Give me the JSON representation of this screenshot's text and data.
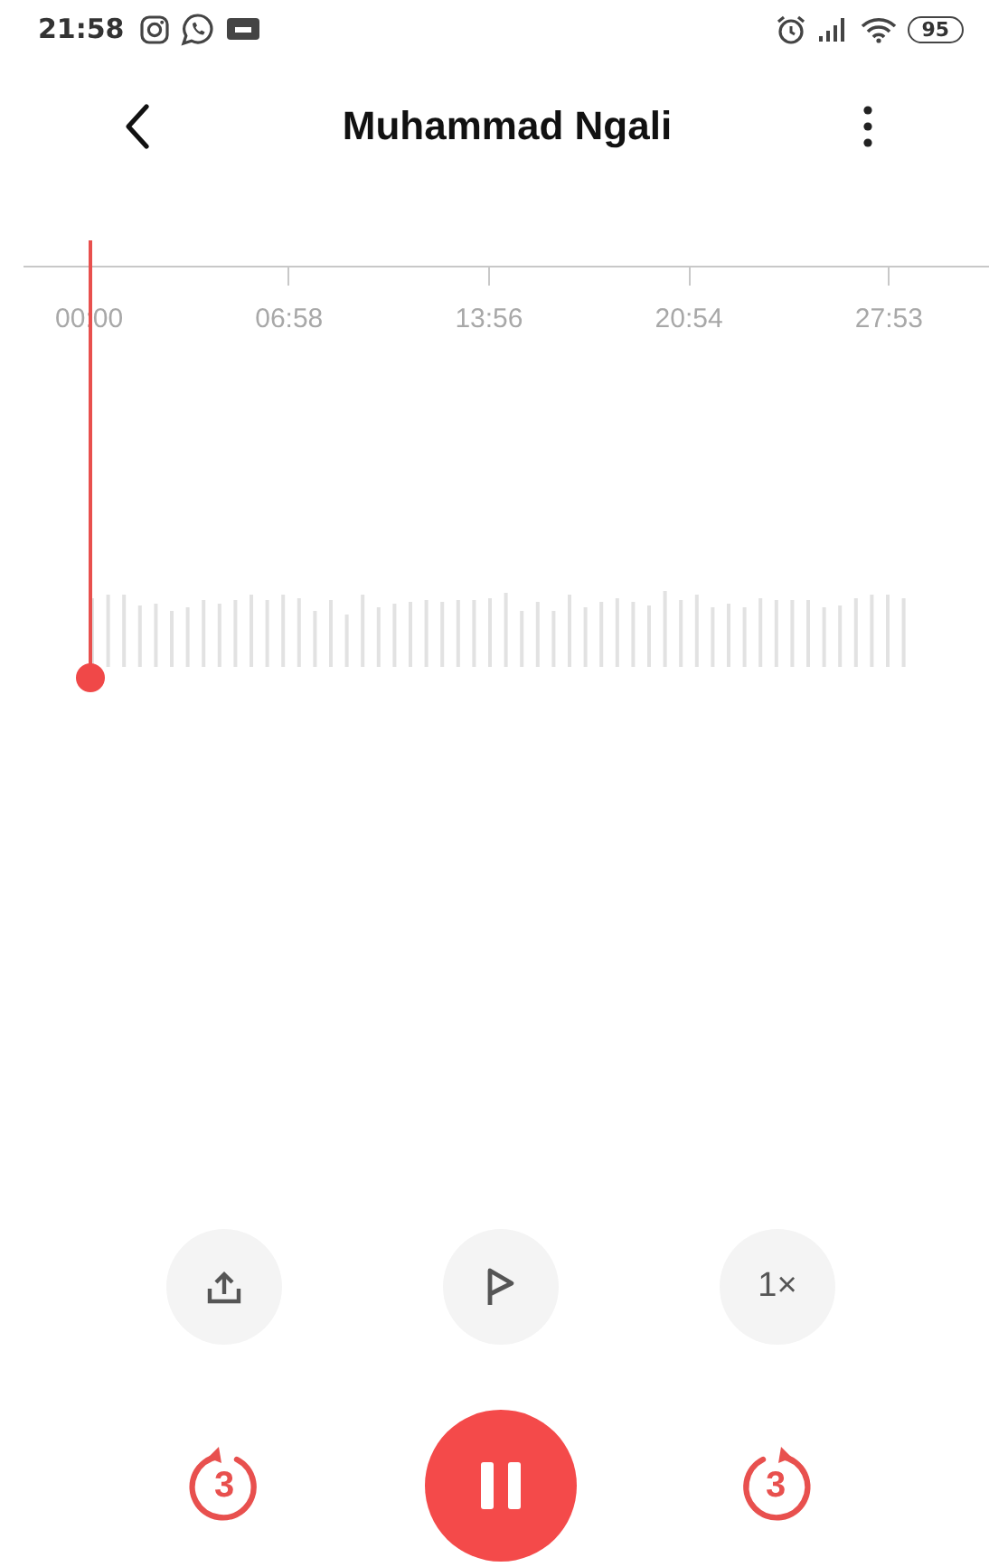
{
  "status_bar": {
    "time": "21:58",
    "battery": "95"
  },
  "header": {
    "title": "Muhammad Ngali"
  },
  "timeline": {
    "ticks": [
      "00:00",
      "06:58",
      "13:56",
      "20:54",
      "27:53"
    ]
  },
  "playback": {
    "level": 0,
    "playing": true
  },
  "actions": [
    {
      "kind": "share"
    },
    {
      "kind": "flag"
    },
    {
      "kind": "speed",
      "label": "1×"
    }
  ],
  "controls": {
    "rewind": "3",
    "forward": "3"
  }
}
